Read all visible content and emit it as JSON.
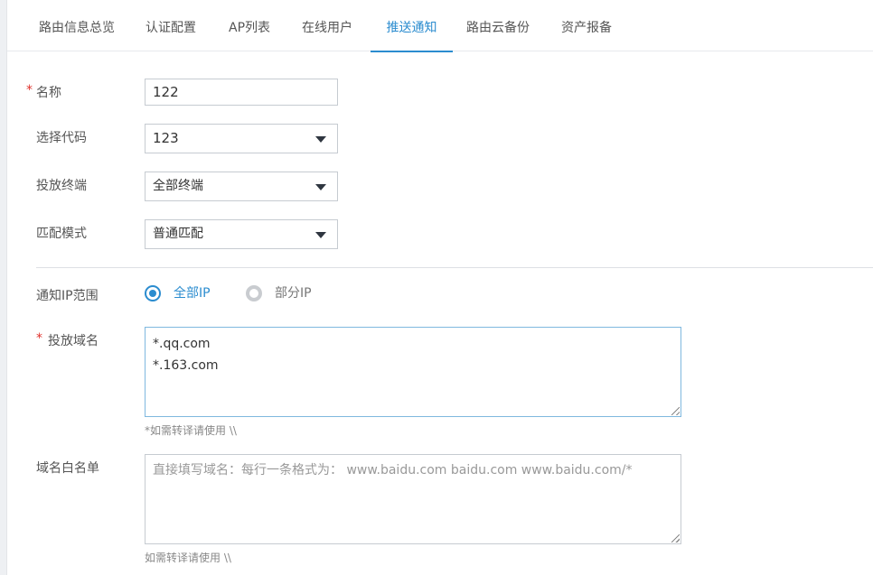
{
  "tabs": [
    {
      "label": "路由信息总览",
      "active": false
    },
    {
      "label": "认证配置",
      "active": false
    },
    {
      "label": "AP列表",
      "active": false
    },
    {
      "label": "在线用户",
      "active": false
    },
    {
      "label": "推送通知",
      "active": true
    },
    {
      "label": "路由云备份",
      "active": false
    },
    {
      "label": "资产报备",
      "active": false
    }
  ],
  "form": {
    "required_mark": "*",
    "name": {
      "label": "名称",
      "value": "122"
    },
    "code": {
      "label": "选择代码",
      "value": "123"
    },
    "terminal": {
      "label": "投放终端",
      "value": "全部终端"
    },
    "match_mode": {
      "label": "匹配模式",
      "value": "普通匹配"
    },
    "ip_range": {
      "label": "通知IP范围",
      "options": [
        {
          "label": "全部IP",
          "selected": true
        },
        {
          "label": "部分IP",
          "selected": false
        }
      ]
    },
    "domains": {
      "label": "投放域名",
      "lines": [
        "*.qq.com",
        "*.163.com"
      ],
      "hint": "*如需转译请使用 \\\\"
    },
    "whitelist": {
      "label": "域名白名单",
      "placeholder": "直接填写域名：每行一条格式为： www.baidu.com  baidu.com    www.baidu.com/*",
      "hint": "如需转译请使用 \\\\"
    }
  },
  "colors": {
    "accent": "#2b8ccf",
    "required": "#e0302b"
  }
}
